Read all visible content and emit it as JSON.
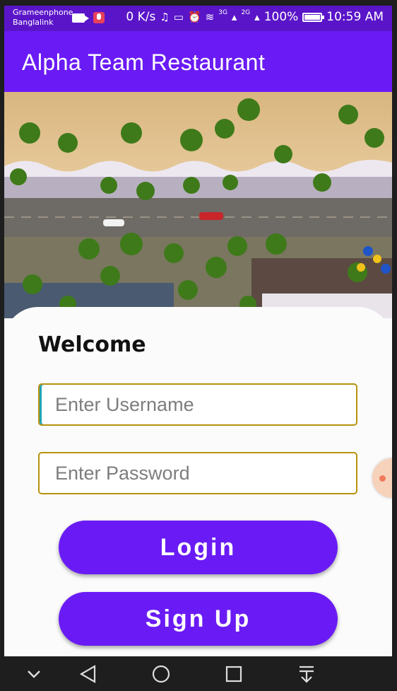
{
  "status_bar": {
    "carrier_1": "Grameenphone",
    "carrier_2": "Banglalink",
    "speed": "0 K/s",
    "network_1": "3G",
    "network_2": "2G",
    "battery": "100%",
    "time": "10:59 AM",
    "battery_level": 1.0
  },
  "app_bar": {
    "title": "Alpha Team Restaurant"
  },
  "hero": {
    "icon": "beach-aerial-image"
  },
  "login_form": {
    "heading": "Welcome",
    "username_placeholder": "Enter Username",
    "password_placeholder": "Enter Password",
    "login_label": "Login",
    "signup_label": "Sign Up"
  },
  "nav_bar": {
    "items": [
      "chevron-down-icon",
      "back-icon",
      "home-icon",
      "recents-icon",
      "notification-pull-icon"
    ]
  },
  "colors": {
    "status_bar": "#5a15c9",
    "primary": "#6a1bf5",
    "input_border": "#b8930e",
    "background": "#fbfbfb"
  }
}
